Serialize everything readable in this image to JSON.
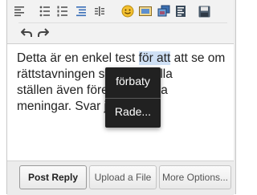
{
  "toolbar": {
    "row1_icons": [
      "align-left-icon",
      "bullet-list-icon",
      "numbered-list-icon",
      "indent-icon",
      "outdent-icon",
      "emoji-icon",
      "image-icon",
      "gallery-icon",
      "code-icon",
      "save-icon"
    ],
    "row2_icons": [
      "undo-icon",
      "redo-icon"
    ]
  },
  "editor": {
    "text_before": "Detta är en enkel test ",
    "text_selected": "för att",
    "text_after": " att se om\nrättstavningen som        n på alla\nställen även föresla         av hela\nmeningar. Svar ja"
  },
  "context_menu": {
    "suggestion": "förbaty",
    "more": "Rade..."
  },
  "buttons": {
    "post_reply": "Post Reply",
    "upload_file": "Upload a File",
    "more_options": "More Options..."
  },
  "colors": {
    "accent": "#1e5fb4",
    "menu_bg": "#212121"
  }
}
